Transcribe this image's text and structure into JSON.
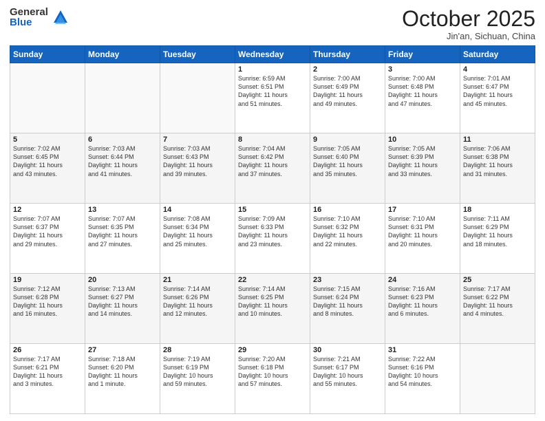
{
  "header": {
    "logo_general": "General",
    "logo_blue": "Blue",
    "month_title": "October 2025",
    "subtitle": "Jin'an, Sichuan, China"
  },
  "days_of_week": [
    "Sunday",
    "Monday",
    "Tuesday",
    "Wednesday",
    "Thursday",
    "Friday",
    "Saturday"
  ],
  "weeks": [
    [
      {
        "day": "",
        "info": ""
      },
      {
        "day": "",
        "info": ""
      },
      {
        "day": "",
        "info": ""
      },
      {
        "day": "1",
        "info": "Sunrise: 6:59 AM\nSunset: 6:51 PM\nDaylight: 11 hours\nand 51 minutes."
      },
      {
        "day": "2",
        "info": "Sunrise: 7:00 AM\nSunset: 6:49 PM\nDaylight: 11 hours\nand 49 minutes."
      },
      {
        "day": "3",
        "info": "Sunrise: 7:00 AM\nSunset: 6:48 PM\nDaylight: 11 hours\nand 47 minutes."
      },
      {
        "day": "4",
        "info": "Sunrise: 7:01 AM\nSunset: 6:47 PM\nDaylight: 11 hours\nand 45 minutes."
      }
    ],
    [
      {
        "day": "5",
        "info": "Sunrise: 7:02 AM\nSunset: 6:45 PM\nDaylight: 11 hours\nand 43 minutes."
      },
      {
        "day": "6",
        "info": "Sunrise: 7:03 AM\nSunset: 6:44 PM\nDaylight: 11 hours\nand 41 minutes."
      },
      {
        "day": "7",
        "info": "Sunrise: 7:03 AM\nSunset: 6:43 PM\nDaylight: 11 hours\nand 39 minutes."
      },
      {
        "day": "8",
        "info": "Sunrise: 7:04 AM\nSunset: 6:42 PM\nDaylight: 11 hours\nand 37 minutes."
      },
      {
        "day": "9",
        "info": "Sunrise: 7:05 AM\nSunset: 6:40 PM\nDaylight: 11 hours\nand 35 minutes."
      },
      {
        "day": "10",
        "info": "Sunrise: 7:05 AM\nSunset: 6:39 PM\nDaylight: 11 hours\nand 33 minutes."
      },
      {
        "day": "11",
        "info": "Sunrise: 7:06 AM\nSunset: 6:38 PM\nDaylight: 11 hours\nand 31 minutes."
      }
    ],
    [
      {
        "day": "12",
        "info": "Sunrise: 7:07 AM\nSunset: 6:37 PM\nDaylight: 11 hours\nand 29 minutes."
      },
      {
        "day": "13",
        "info": "Sunrise: 7:07 AM\nSunset: 6:35 PM\nDaylight: 11 hours\nand 27 minutes."
      },
      {
        "day": "14",
        "info": "Sunrise: 7:08 AM\nSunset: 6:34 PM\nDaylight: 11 hours\nand 25 minutes."
      },
      {
        "day": "15",
        "info": "Sunrise: 7:09 AM\nSunset: 6:33 PM\nDaylight: 11 hours\nand 23 minutes."
      },
      {
        "day": "16",
        "info": "Sunrise: 7:10 AM\nSunset: 6:32 PM\nDaylight: 11 hours\nand 22 minutes."
      },
      {
        "day": "17",
        "info": "Sunrise: 7:10 AM\nSunset: 6:31 PM\nDaylight: 11 hours\nand 20 minutes."
      },
      {
        "day": "18",
        "info": "Sunrise: 7:11 AM\nSunset: 6:29 PM\nDaylight: 11 hours\nand 18 minutes."
      }
    ],
    [
      {
        "day": "19",
        "info": "Sunrise: 7:12 AM\nSunset: 6:28 PM\nDaylight: 11 hours\nand 16 minutes."
      },
      {
        "day": "20",
        "info": "Sunrise: 7:13 AM\nSunset: 6:27 PM\nDaylight: 11 hours\nand 14 minutes."
      },
      {
        "day": "21",
        "info": "Sunrise: 7:14 AM\nSunset: 6:26 PM\nDaylight: 11 hours\nand 12 minutes."
      },
      {
        "day": "22",
        "info": "Sunrise: 7:14 AM\nSunset: 6:25 PM\nDaylight: 11 hours\nand 10 minutes."
      },
      {
        "day": "23",
        "info": "Sunrise: 7:15 AM\nSunset: 6:24 PM\nDaylight: 11 hours\nand 8 minutes."
      },
      {
        "day": "24",
        "info": "Sunrise: 7:16 AM\nSunset: 6:23 PM\nDaylight: 11 hours\nand 6 minutes."
      },
      {
        "day": "25",
        "info": "Sunrise: 7:17 AM\nSunset: 6:22 PM\nDaylight: 11 hours\nand 4 minutes."
      }
    ],
    [
      {
        "day": "26",
        "info": "Sunrise: 7:17 AM\nSunset: 6:21 PM\nDaylight: 11 hours\nand 3 minutes."
      },
      {
        "day": "27",
        "info": "Sunrise: 7:18 AM\nSunset: 6:20 PM\nDaylight: 11 hours\nand 1 minute."
      },
      {
        "day": "28",
        "info": "Sunrise: 7:19 AM\nSunset: 6:19 PM\nDaylight: 10 hours\nand 59 minutes."
      },
      {
        "day": "29",
        "info": "Sunrise: 7:20 AM\nSunset: 6:18 PM\nDaylight: 10 hours\nand 57 minutes."
      },
      {
        "day": "30",
        "info": "Sunrise: 7:21 AM\nSunset: 6:17 PM\nDaylight: 10 hours\nand 55 minutes."
      },
      {
        "day": "31",
        "info": "Sunrise: 7:22 AM\nSunset: 6:16 PM\nDaylight: 10 hours\nand 54 minutes."
      },
      {
        "day": "",
        "info": ""
      }
    ]
  ]
}
